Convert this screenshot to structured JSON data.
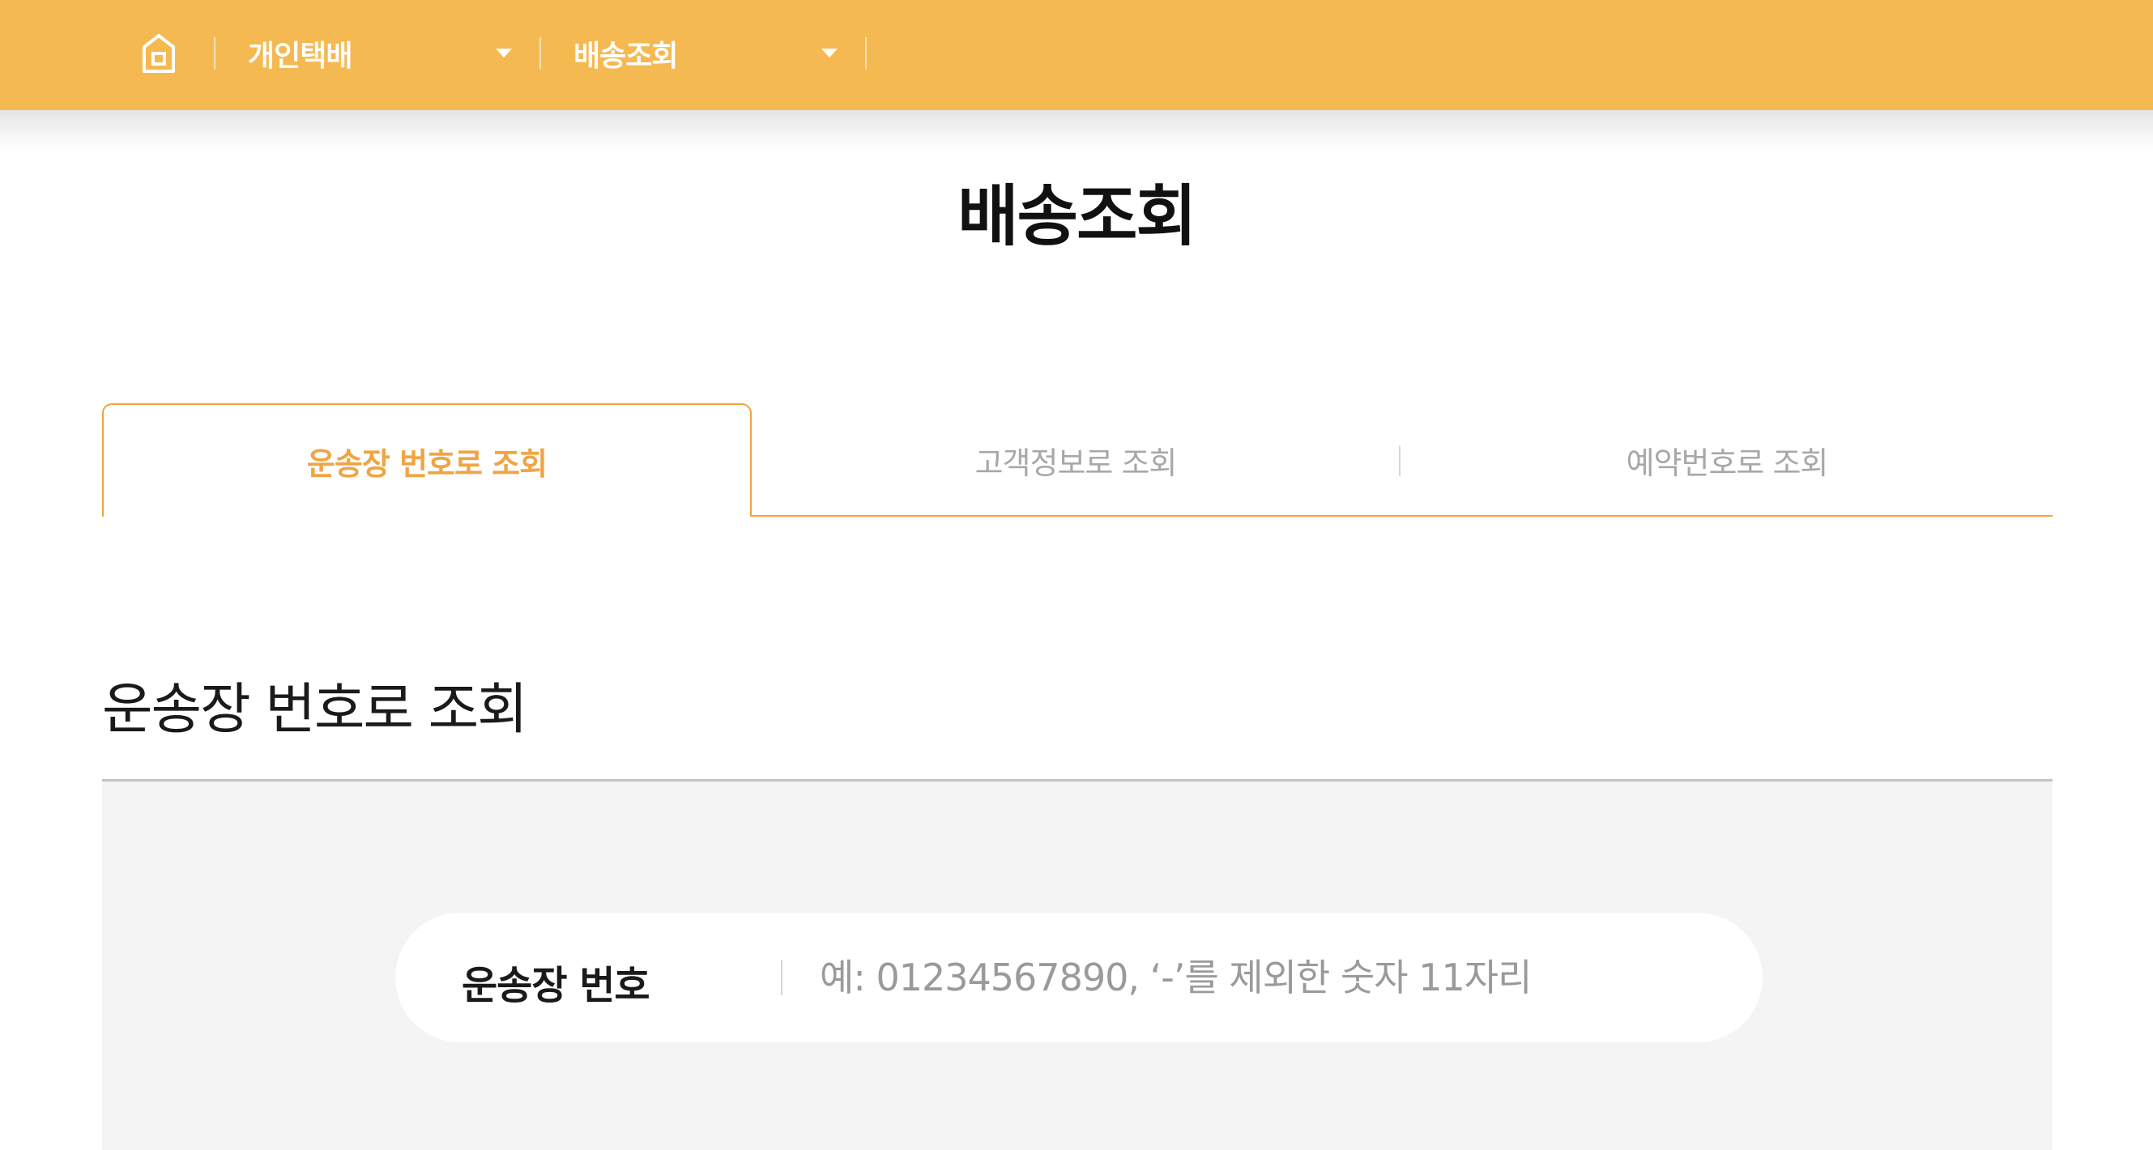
{
  "theme": {
    "brand": "#f5b952",
    "accent": "#f0a442"
  },
  "header": {
    "home_icon": "home-icon",
    "nav_1": {
      "label": "개인택배",
      "icon": "caret-down-icon"
    },
    "nav_2": {
      "label": "배송조회",
      "icon": "caret-down-icon"
    }
  },
  "page": {
    "title": "배송조회"
  },
  "tabs": [
    {
      "label": "운송장 번호로 조회",
      "active": true
    },
    {
      "label": "고객정보로 조회",
      "active": false
    },
    {
      "label": "예약번호로 조회",
      "active": false
    }
  ],
  "section": {
    "title": "운송장 번호로 조회"
  },
  "search": {
    "label": "운송장 번호",
    "value": "",
    "placeholder": "예: 01234567890, ‘-’를 제외한 숫자 11자리"
  }
}
